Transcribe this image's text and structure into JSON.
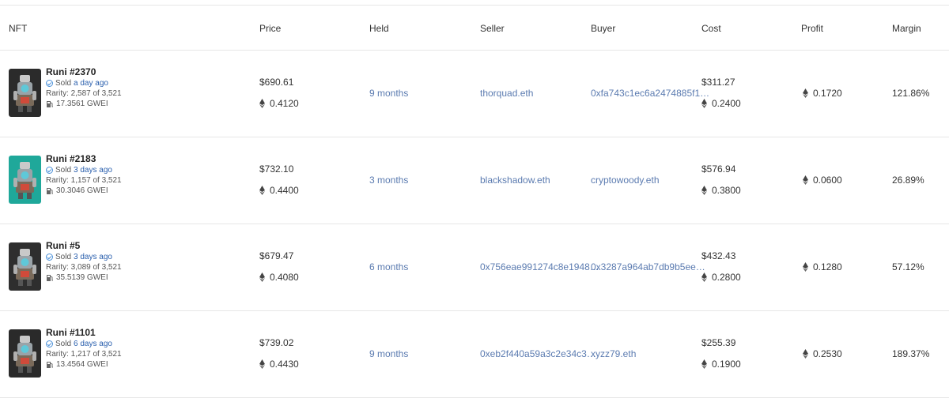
{
  "headers": {
    "nft": "NFT",
    "price": "Price",
    "held": "Held",
    "seller": "Seller",
    "buyer": "Buyer",
    "cost": "Cost",
    "profit": "Profit",
    "margin": "Margin"
  },
  "rows": [
    {
      "name": "Runi #2370",
      "sold_prefix": "Sold",
      "sold_when": "a day ago",
      "rarity": "Rarity: 2,587 of 3,521",
      "gas": "17.3561 GWEI",
      "price_usd": "$690.61",
      "price_eth": "0.4120",
      "held": "9 months",
      "seller": "thorquad.eth",
      "buyer": "0xfa743c1ec6a2474885f1…",
      "cost_usd": "$311.27",
      "cost_eth": "0.2400",
      "profit_eth": "0.1720",
      "margin": "121.86%",
      "thumb_bg": "#2b2b2b"
    },
    {
      "name": "Runi #2183",
      "sold_prefix": "Sold",
      "sold_when": "3 days ago",
      "rarity": "Rarity: 1,157 of 3,521",
      "gas": "30.3046 GWEI",
      "price_usd": "$732.10",
      "price_eth": "0.4400",
      "held": "3 months",
      "seller": "blackshadow.eth",
      "buyer": "cryptowoody.eth",
      "cost_usd": "$576.94",
      "cost_eth": "0.3800",
      "profit_eth": "0.0600",
      "margin": "26.89%",
      "thumb_bg": "#1fa89a"
    },
    {
      "name": "Runi #5",
      "sold_prefix": "Sold",
      "sold_when": "3 days ago",
      "rarity": "Rarity: 3,089 of 3,521",
      "gas": "35.5139 GWEI",
      "price_usd": "$679.47",
      "price_eth": "0.4080",
      "held": "6 months",
      "seller": "0x756eae991274c8e1948…",
      "buyer": "0x3287a964ab7db9b5ee…",
      "cost_usd": "$432.43",
      "cost_eth": "0.2800",
      "profit_eth": "0.1280",
      "margin": "57.12%",
      "thumb_bg": "#2e2e2e"
    },
    {
      "name": "Runi #1101",
      "sold_prefix": "Sold",
      "sold_when": "6 days ago",
      "rarity": "Rarity: 1,217 of 3,521",
      "gas": "13.4564 GWEI",
      "price_usd": "$739.02",
      "price_eth": "0.4430",
      "held": "9 months",
      "seller": "0xeb2f440a59a3c2e34c3…",
      "buyer": "xyzz79.eth",
      "cost_usd": "$255.39",
      "cost_eth": "0.1900",
      "profit_eth": "0.2530",
      "margin": "189.37%",
      "thumb_bg": "#2a2a2a"
    }
  ]
}
